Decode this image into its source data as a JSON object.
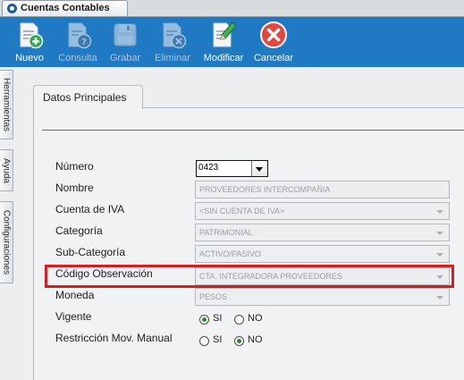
{
  "window": {
    "tab_title": "Cuentas Contables"
  },
  "toolbar": {
    "buttons": [
      {
        "label": "Nuevo",
        "enabled": true
      },
      {
        "label": "Consulta",
        "enabled": false
      },
      {
        "label": "Grabar",
        "enabled": false
      },
      {
        "label": "Eliminar",
        "enabled": false
      },
      {
        "label": "Modificar",
        "enabled": true
      },
      {
        "label": "Cancelar",
        "enabled": true
      }
    ]
  },
  "side_tabs": [
    "Herramientas",
    "Ayuda",
    "Configuraciones"
  ],
  "section": {
    "tab_label": "Datos Principales"
  },
  "form": {
    "numero": {
      "label": "Número",
      "value": "0423"
    },
    "nombre": {
      "label": "Nombre",
      "value": "PROVEEDORES INTERCOMPAÑIA"
    },
    "cuenta_iva": {
      "label": "Cuenta de IVA",
      "value": "<SIN CUENTA DE IVA>"
    },
    "categoria": {
      "label": "Categoría",
      "value": "PATRIMONIAL"
    },
    "subcategoria": {
      "label": "Sub-Categoría",
      "value": "ACTIVO/PASIVO"
    },
    "codigo_observacion": {
      "label": "Código Observación",
      "value": "CTA. INTEGRADORA PROVEEDORES"
    },
    "moneda": {
      "label": "Moneda",
      "value": "PESOS"
    },
    "vigente": {
      "label": "Vigente",
      "si": "SI",
      "no": "NO",
      "selected": "SI"
    },
    "restriccion": {
      "label": "Restricción Mov. Manual",
      "si": "SI",
      "no": "NO",
      "selected": "NO"
    }
  },
  "colors": {
    "toolbar": "#1f79c3",
    "highlight": "#d21f22",
    "accent": "#2f7cc1"
  }
}
